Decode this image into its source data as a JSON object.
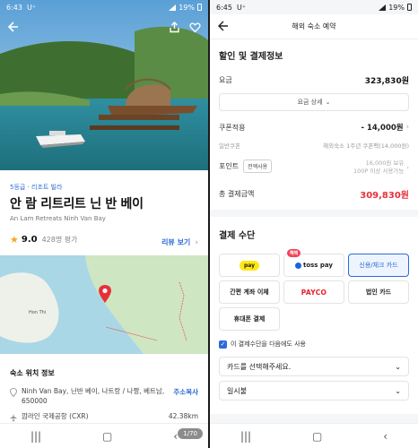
{
  "left": {
    "status": {
      "time": "6:43",
      "carrier": "U⁺",
      "battery": "19%"
    },
    "hero": {
      "counter": "1/70"
    },
    "hotel": {
      "grade": "5등급 · 리조트 빌라",
      "name": "안 람 리트리트 닌 반 베이",
      "name_en": "An Lam Retreats Ninh Van Bay",
      "score": "9.0",
      "reviews": "428명 평가",
      "review_link": "리뷰 보기"
    },
    "map": {
      "place": "Hon Thi"
    },
    "location": {
      "title": "숙소 위치 정보",
      "address": "Ninh Van Bay, 닌반 베이, 나트랑 / 나짱, 베트남, 650000",
      "copy": "주소복사",
      "airport": "깜라인 국제공항 (CXR)",
      "distance": "42.38km"
    }
  },
  "right": {
    "status": {
      "time": "6:45",
      "carrier": "U⁺",
      "battery": "19%"
    },
    "header": {
      "title": "해외 숙소 예약"
    },
    "pricing": {
      "title": "할인 및 결제정보",
      "fee_label": "요금",
      "fee_value": "323,830원",
      "detail_btn": "요금 상세",
      "coupon_label": "쿠폰적용",
      "coupon_value": "- 14,000원",
      "general_coupon_label": "일반쿠폰",
      "general_coupon_value": "해외숙소 1주년 쿠폰팩(14,000원)",
      "point_label": "포인트",
      "point_btn": "전액사용",
      "point_held": "16,000원 보유",
      "point_note": "100P 이상 사용가능",
      "total_label": "총 결제금액",
      "total_value": "309,830원"
    },
    "payment": {
      "title": "결제 수단",
      "kakao": "pay",
      "toss": "toss pay",
      "toss_badge": "혜택",
      "card": "신용/체크 카드",
      "bank": "간편 계좌 이체",
      "payco": "PAYCO",
      "corp": "법인 카드",
      "phone": "휴대폰 결제",
      "remember": "이 결제수단을 다음에도 사용",
      "card_select": "카드를 선택해주세요.",
      "installment": "일시불"
    },
    "colors": {
      "accent": "#2a6bd8",
      "price": "#e8303a"
    }
  }
}
